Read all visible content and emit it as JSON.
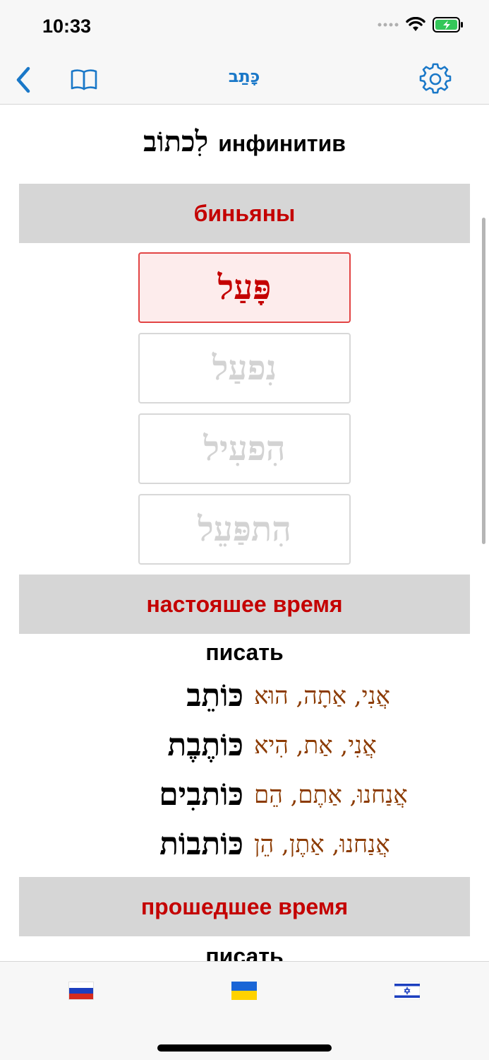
{
  "status": {
    "time": "10:33"
  },
  "nav": {
    "title": "כָּתַב",
    "back_icon": "chevron-left-icon",
    "dictionary_icon": "book-icon",
    "settings_icon": "gear-icon",
    "accent": "#1a78c8"
  },
  "infinitive": {
    "hebrew": "לִכתוֹב",
    "label": "инфинитив"
  },
  "sections": {
    "binyanim": "биньяны",
    "present": "настояшее время",
    "past": "прошедшее время"
  },
  "binyanim": [
    {
      "label": "פָּעַל",
      "selected": true
    },
    {
      "label": "נִפעַל",
      "selected": false
    },
    {
      "label": "הִפעִיל",
      "selected": false
    },
    {
      "label": "הִתפַּעֵל",
      "selected": false
    }
  ],
  "present": {
    "meaning": "писать",
    "rows": [
      {
        "pronouns": "אֲנִי, אַתָה, הוּא",
        "form": "כּוֹתֵב"
      },
      {
        "pronouns": "אֲנִי, אַת, הִיא",
        "form": "כּוֹתֶבֶת"
      },
      {
        "pronouns": "אֲנַחנוּ, אַתֶם, הֵם",
        "form": "כּוֹתבִים"
      },
      {
        "pronouns": "אֲנַחנוּ, אַתֶן, הֵן",
        "form": "כּוֹתבוֹת"
      }
    ]
  },
  "past": {
    "meaning": "писать"
  },
  "tabs": [
    {
      "name": "russian",
      "icon": "russia-flag-icon"
    },
    {
      "name": "ukrainian",
      "icon": "ukraine-flag-icon"
    },
    {
      "name": "hebrew",
      "icon": "israel-flag-icon"
    }
  ],
  "colors": {
    "header_text": "#c40000",
    "header_bg": "#d6d6d6",
    "pronoun": "#8b3a00"
  }
}
